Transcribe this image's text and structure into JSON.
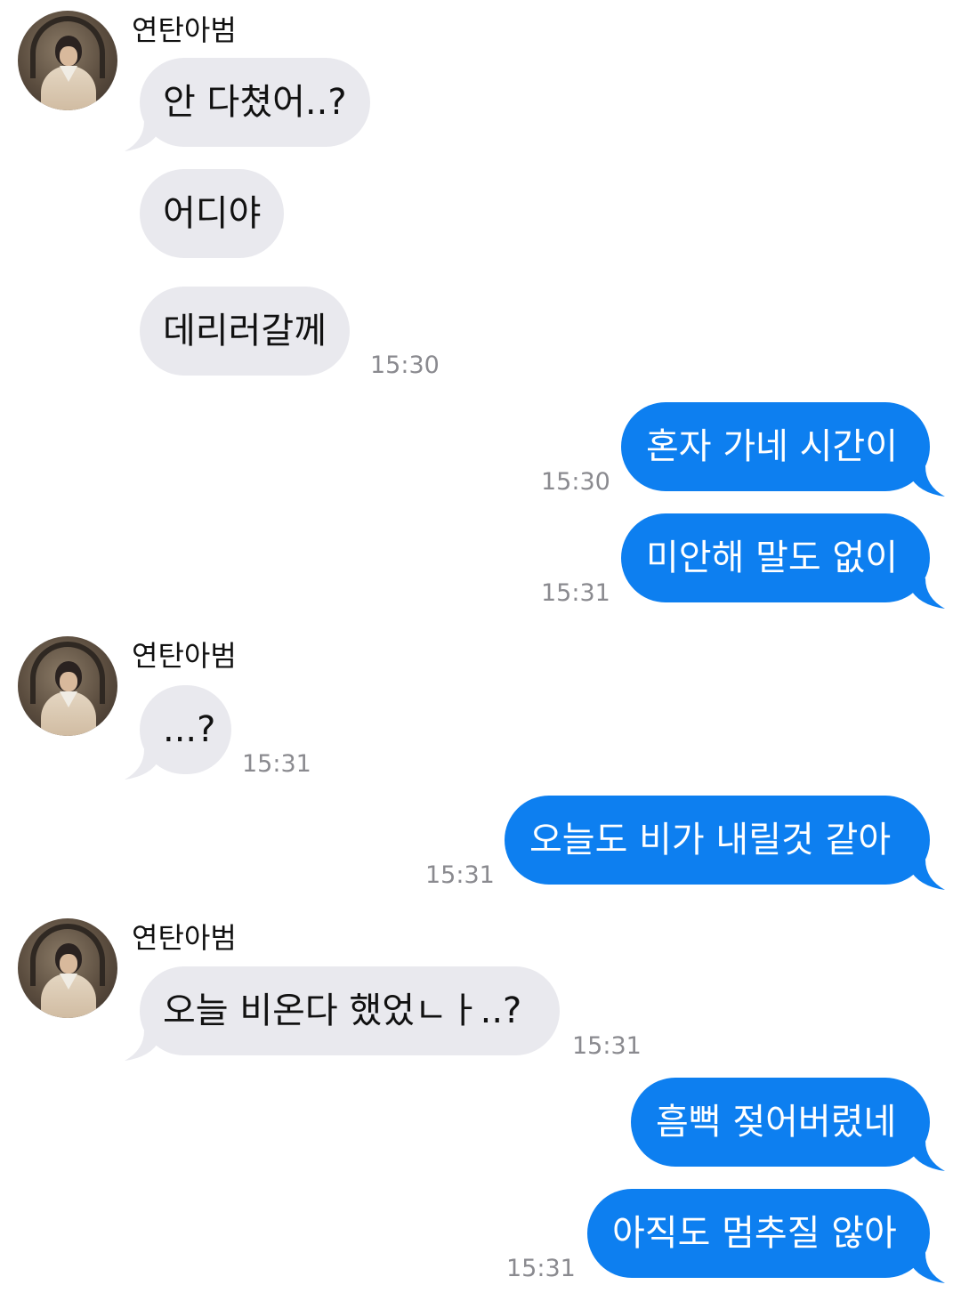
{
  "sender": {
    "name": "연탄아범",
    "avatar": "profile-photo"
  },
  "colors": {
    "incoming_bubble": "#e9e9ee",
    "outgoing_bubble": "#0d7ff0",
    "timestamp": "#8a8a8f"
  },
  "messages": [
    {
      "dir": "in",
      "text": "안 다쳤어..?",
      "time": ""
    },
    {
      "dir": "in",
      "text": "어디야",
      "time": ""
    },
    {
      "dir": "in",
      "text": "데리러갈께",
      "time": "15:30"
    },
    {
      "dir": "out",
      "text": "혼자 가네 시간이",
      "time": "15:30"
    },
    {
      "dir": "out",
      "text": "미안해 말도 없이",
      "time": "15:31"
    },
    {
      "dir": "in",
      "text": "...?",
      "time": "15:31"
    },
    {
      "dir": "out",
      "text": "오늘도 비가 내릴것 같아",
      "time": "15:31"
    },
    {
      "dir": "in",
      "text": "오늘 비온다 했었ㄴㅏ..?",
      "time": "15:31"
    },
    {
      "dir": "out",
      "text": "흠뻑 젖어버렸네",
      "time": ""
    },
    {
      "dir": "out",
      "text": "아직도 멈추질 않아",
      "time": "15:31"
    }
  ]
}
